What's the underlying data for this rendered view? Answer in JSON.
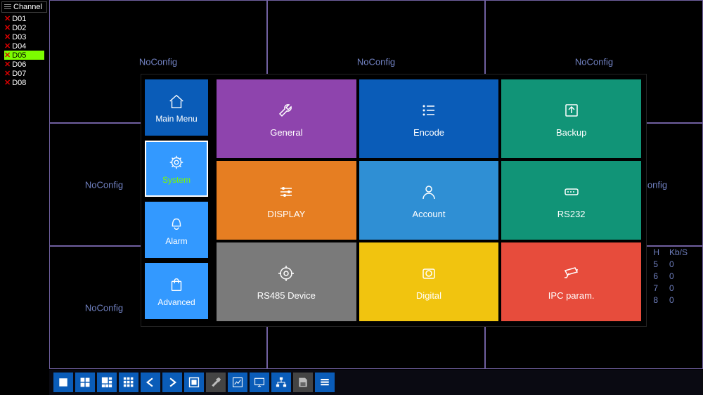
{
  "sidebar": {
    "title": "Channel",
    "channels": [
      {
        "id": "D01",
        "active": false
      },
      {
        "id": "D02",
        "active": false
      },
      {
        "id": "D03",
        "active": false
      },
      {
        "id": "D04",
        "active": false
      },
      {
        "id": "D05",
        "active": true
      },
      {
        "id": "D06",
        "active": false
      },
      {
        "id": "D07",
        "active": false
      },
      {
        "id": "D08",
        "active": false
      }
    ]
  },
  "cells": {
    "noconfig": "NoConfig"
  },
  "stats": {
    "headers": {
      "h": "H",
      "kbs": "Kb/S"
    },
    "rows": [
      {
        "h": "5",
        "kbs": "0"
      },
      {
        "h": "6",
        "kbs": "0"
      },
      {
        "h": "7",
        "kbs": "0"
      },
      {
        "h": "8",
        "kbs": "0"
      }
    ]
  },
  "menu": {
    "side": [
      {
        "label": "Main Menu",
        "color": "#0a5cb8",
        "icon": "home"
      },
      {
        "label": "System",
        "color": "#3399ff",
        "icon": "gear",
        "active": true,
        "labelColor": "#7cfc00"
      },
      {
        "label": "Alarm",
        "color": "#3399ff",
        "icon": "bell"
      },
      {
        "label": "Advanced",
        "color": "#3399ff",
        "icon": "bag"
      }
    ],
    "tiles": [
      {
        "label": "General",
        "color": "#8e44ad",
        "icon": "wrench"
      },
      {
        "label": "Encode",
        "color": "#0a5cb8",
        "icon": "list"
      },
      {
        "label": "Backup",
        "color": "#119477",
        "icon": "upload"
      },
      {
        "label": "DISPLAY",
        "color": "#e67e22",
        "icon": "sliders"
      },
      {
        "label": "Account",
        "color": "#2f8fd4",
        "icon": "user"
      },
      {
        "label": "RS232",
        "color": "#119477",
        "icon": "port"
      },
      {
        "label": "RS485 Device",
        "color": "#7a7a7a",
        "icon": "target"
      },
      {
        "label": "Digital",
        "color": "#f1c40f",
        "icon": "camera"
      },
      {
        "label": "IPC param.",
        "color": "#e74c3c",
        "icon": "cctv"
      }
    ]
  },
  "toolbar": {
    "items": [
      {
        "icon": "view1",
        "style": "blue"
      },
      {
        "icon": "view4",
        "style": "blue"
      },
      {
        "icon": "view8",
        "style": "blue"
      },
      {
        "icon": "view9",
        "style": "blue"
      },
      {
        "icon": "arrow-left",
        "style": "blue"
      },
      {
        "icon": "arrow-right",
        "style": "blue"
      },
      {
        "icon": "fullscreen",
        "style": "blue"
      },
      {
        "icon": "hammer",
        "style": "dark"
      },
      {
        "icon": "chart",
        "style": "blue"
      },
      {
        "icon": "monitor",
        "style": "blue"
      },
      {
        "icon": "network",
        "style": "blue"
      },
      {
        "icon": "disk",
        "style": "dark"
      },
      {
        "icon": "menu",
        "style": "blue"
      }
    ]
  }
}
